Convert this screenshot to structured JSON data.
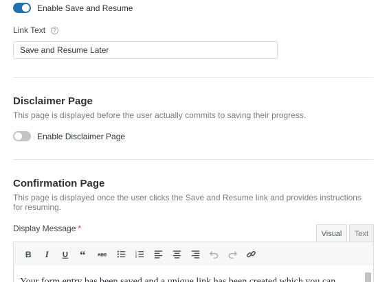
{
  "save_resume": {
    "toggle_label": "Enable Save and Resume",
    "toggle_on": true,
    "link_text_label": "Link Text",
    "link_text_value": "Save and Resume Later"
  },
  "disclaimer": {
    "title": "Disclaimer Page",
    "description": "This page is displayed before the user actually commits to saving their progress.",
    "toggle_label": "Enable Disclaimer Page",
    "toggle_on": false
  },
  "confirmation": {
    "title": "Confirmation Page",
    "description": "This page is displayed once the user clicks the Save and Resume link and provides instructions for resuming.",
    "display_message_label": "Display Message",
    "required_mark": "*"
  },
  "editor": {
    "tabs": [
      "Visual",
      "Text"
    ],
    "active_tab": "Visual",
    "toolbar": [
      "bold-icon",
      "italic-icon",
      "underline-icon",
      "blockquote-icon",
      "strikethrough-icon",
      "bulleted-list-icon",
      "numbered-list-icon",
      "align-left-icon",
      "align-center-icon",
      "align-right-icon",
      "undo-icon",
      "redo-icon",
      "link-icon"
    ],
    "content": "Your form entry has been saved and a unique link has been created which you can"
  },
  "colors": {
    "accent": "#2271b1",
    "required": "#d63638"
  }
}
